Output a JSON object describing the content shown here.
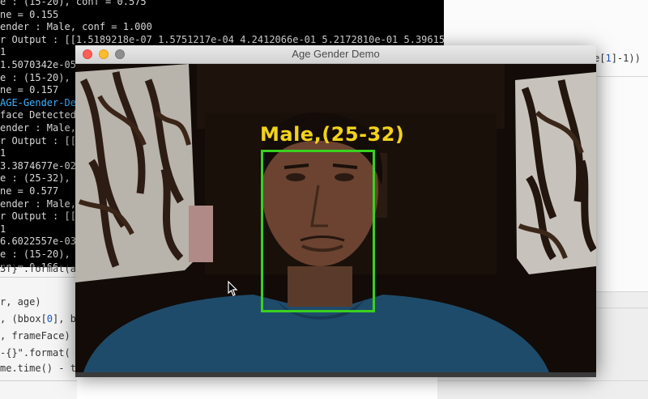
{
  "window": {
    "title": "Age Gender Demo"
  },
  "overlay": {
    "label": "Male,(25-32)",
    "box_color": "#39d11f",
    "label_color": "#f2d319"
  },
  "terminal": {
    "lines": [
      "e : (15-20), conf = 0.575",
      "ne = 0.155",
      "ender : Male, conf = 1.000",
      "r Output : [[1.5189218e-07 1.5751217e-04 4.2412066e-01 5.2172810e-01 5.3961582",
      "1",
      "1.5070342e-05",
      "e : (15-20), c",
      "ne = 0.157",
      "AGE-Gender-De",
      "face Detected",
      "ender : Male, c",
      "r Output : [[1",
      "1",
      "3.3874677e-02",
      "e : (25-32), c",
      "ne = 0.577",
      "ender : Male, c",
      "r Output : [[5",
      "1",
      "6.6022557e-03",
      "e : (15-20), c",
      "ne = 0.166"
    ]
  },
  "code_left": {
    "line1_a": "3f}\".format(a",
    "line2": "r, age)",
    "line3_a": ", (bbox[",
    "line3_num": "0",
    "line3_b": "], b",
    "line4": ", frameFace)",
    "line5": "-{}\".format(",
    "line6_a": "me.time() - t"
  },
  "editor": {
    "frag_a": "e[",
    "frag_num": "1",
    "frag_b": "]-1))"
  }
}
